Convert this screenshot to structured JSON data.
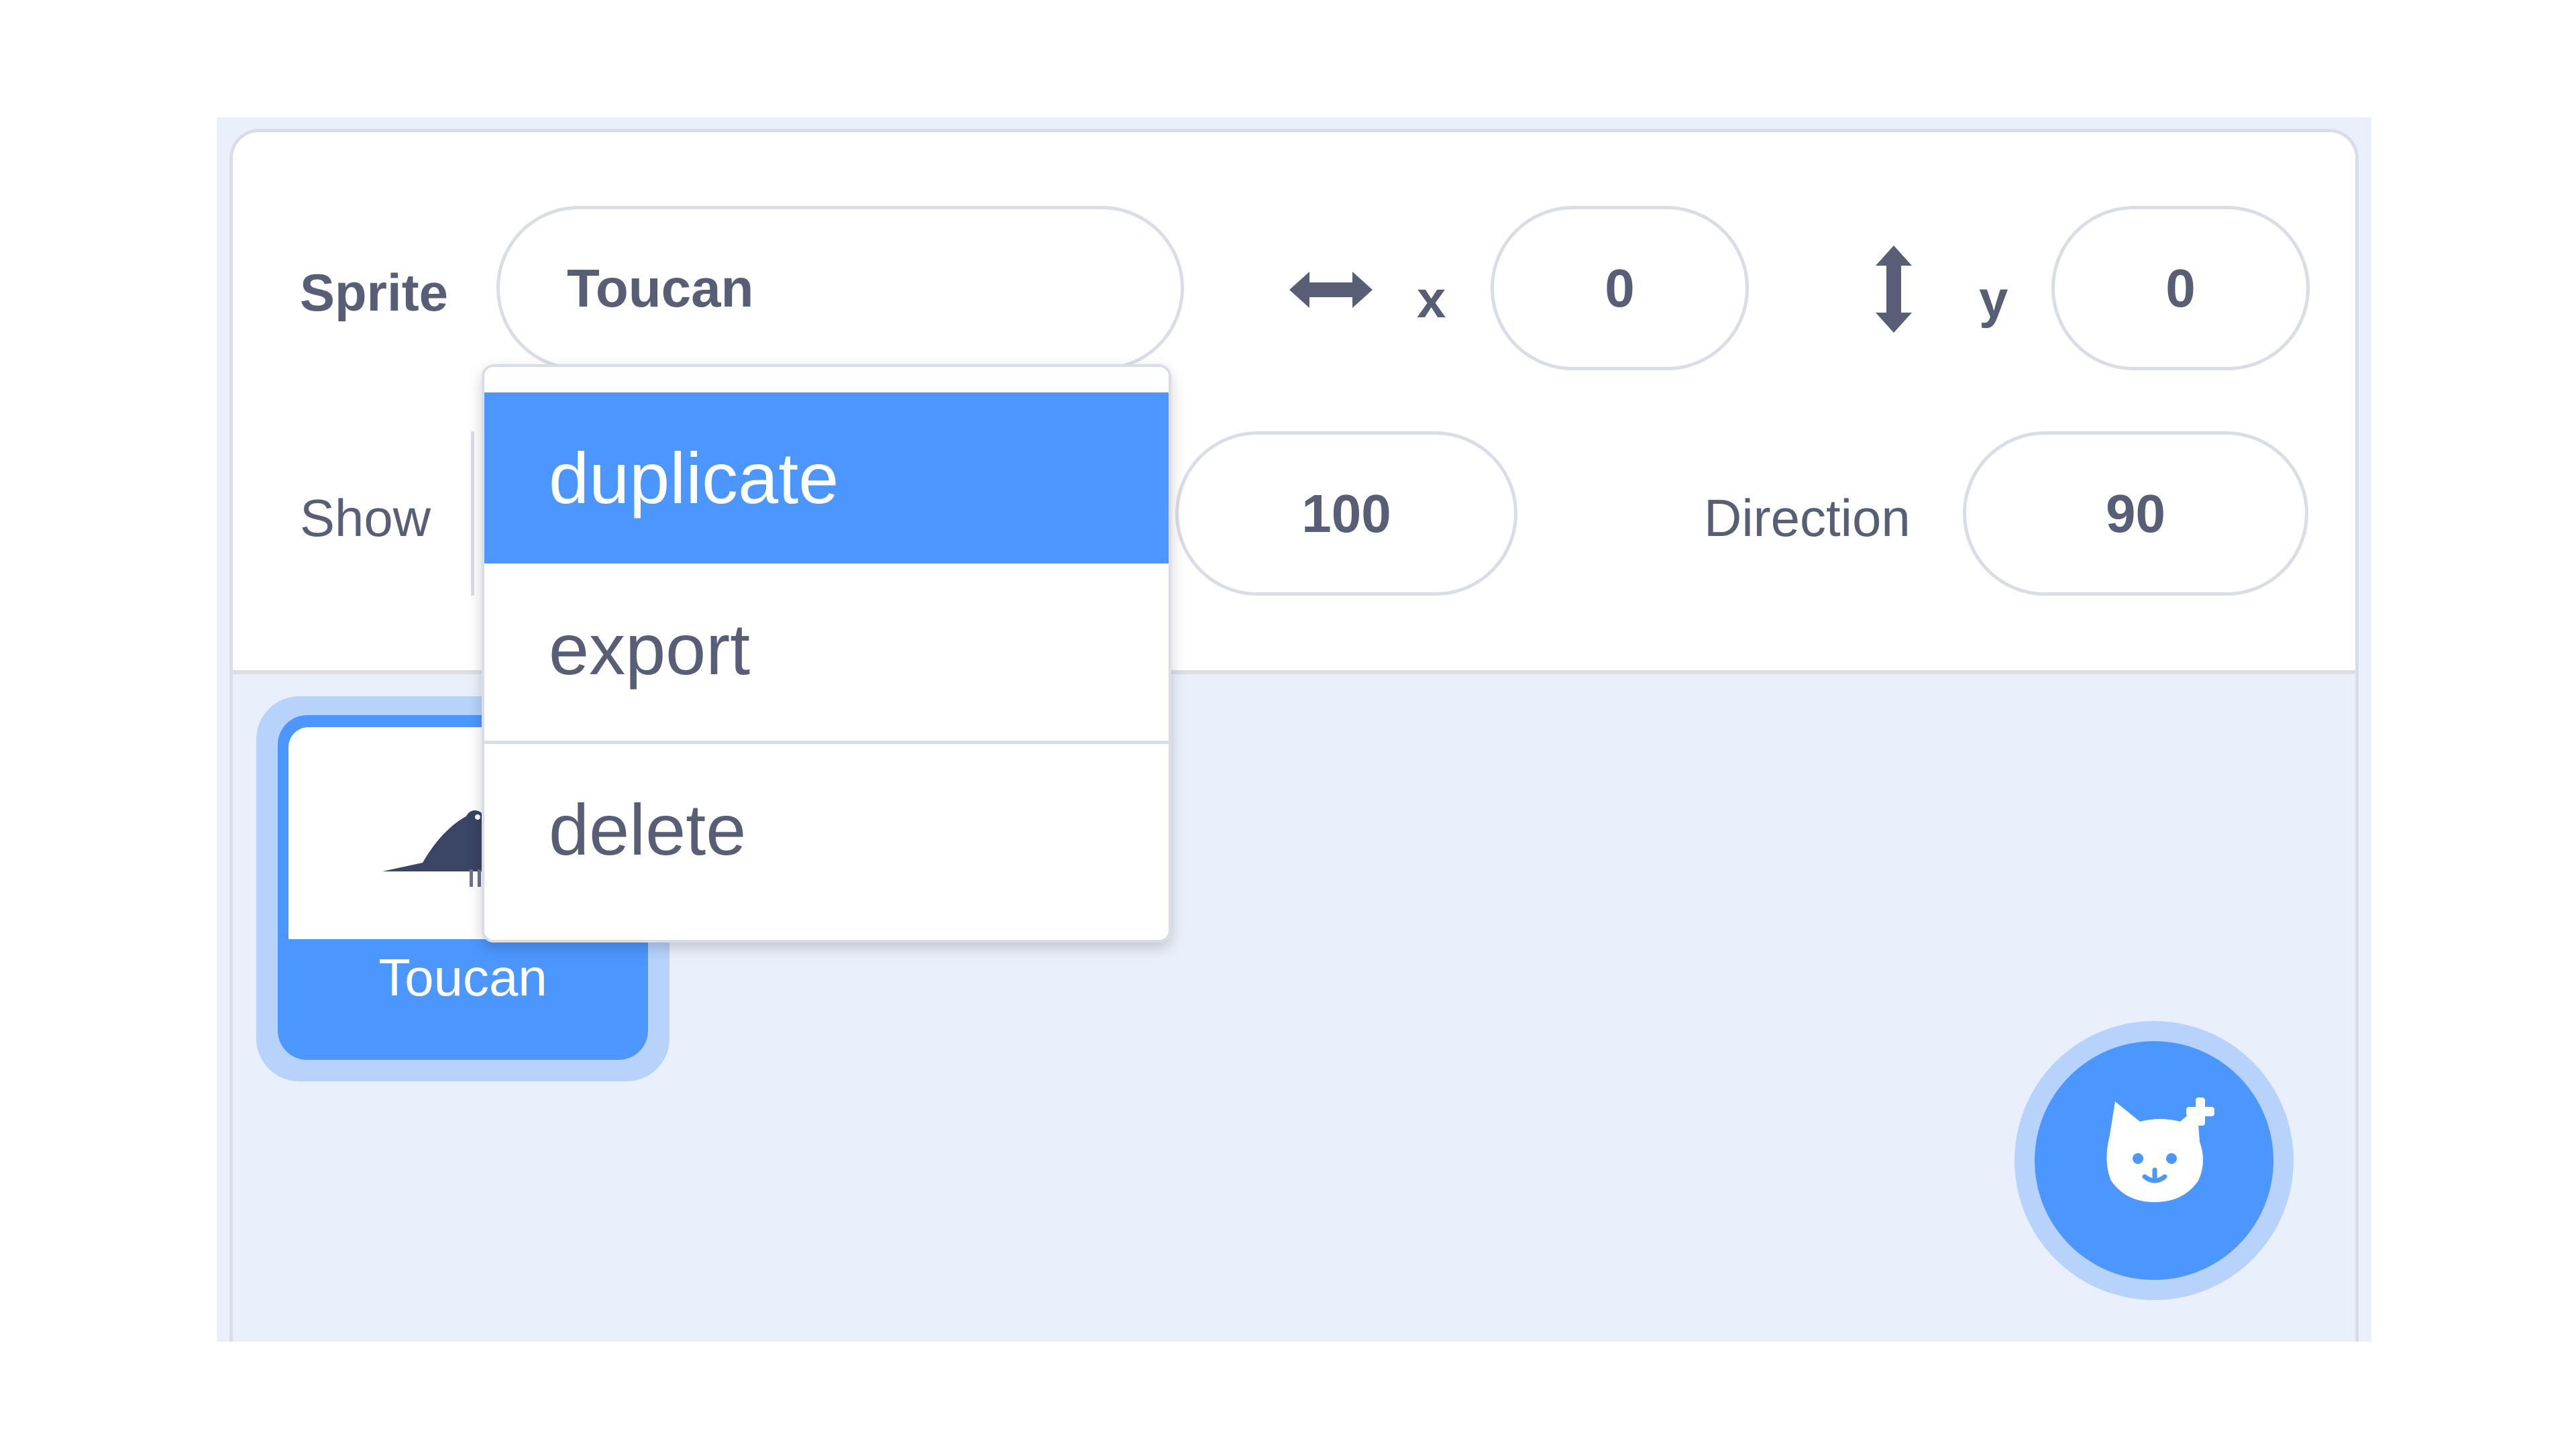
{
  "sprite_info": {
    "sprite_label": "Sprite",
    "sprite_name_value": "Toucan",
    "x_label": "x",
    "x_value": "0",
    "y_label": "y",
    "y_value": "0",
    "show_label": "Show",
    "size_value": "100",
    "direction_label": "Direction",
    "direction_value": "90"
  },
  "sprite_list": {
    "items": [
      {
        "name": "Toucan",
        "selected": true
      }
    ]
  },
  "context_menu": {
    "items": [
      {
        "label": "duplicate",
        "highlighted": true
      },
      {
        "label": "export",
        "highlighted": false
      },
      {
        "label": "delete",
        "highlighted": false
      }
    ]
  },
  "colors": {
    "accent": "#4c97ff",
    "accent_light": "#b7d2fb",
    "text": "#575e75",
    "border": "#d9dee6",
    "pane_background": "#e9f0fb"
  },
  "icons": {
    "horizontal_arrows": "arrows-horizontal-icon",
    "vertical_arrows": "arrows-vertical-icon",
    "sprite_thumbnail": "toucan-icon",
    "add_sprite": "cat-plus-icon"
  }
}
